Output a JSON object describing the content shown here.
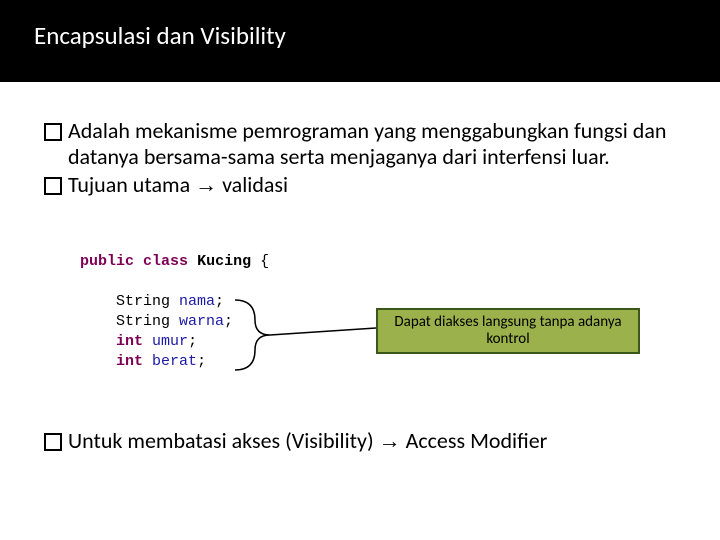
{
  "title": "Encapsulasi dan Visibility",
  "bullets": {
    "b1": "Adalah mekanisme pemrograman yang menggabungkan fungsi dan datanya bersama-sama serta menjaganya dari interfensi luar.",
    "b2_pre": "Tujuan utama ",
    "b2_post": " validasi",
    "b3_pre": "Untuk membatasi akses (Visibility) ",
    "b3_post": " Access Modifier"
  },
  "arrow": "→",
  "code": {
    "l1_kw1": "public",
    "l1_kw2": "class",
    "l1_cls": "Kucing",
    "l1_brace": " {",
    "l3_t": "String ",
    "l3_f": "nama",
    "l4_t": "String ",
    "l4_f": "warna",
    "l5_t": "int",
    "l5_f": "umur",
    "l6_t": "int",
    "l6_f": "berat",
    "semi": ";"
  },
  "callout": "Dapat diakses langsung tanpa adanya kontrol"
}
